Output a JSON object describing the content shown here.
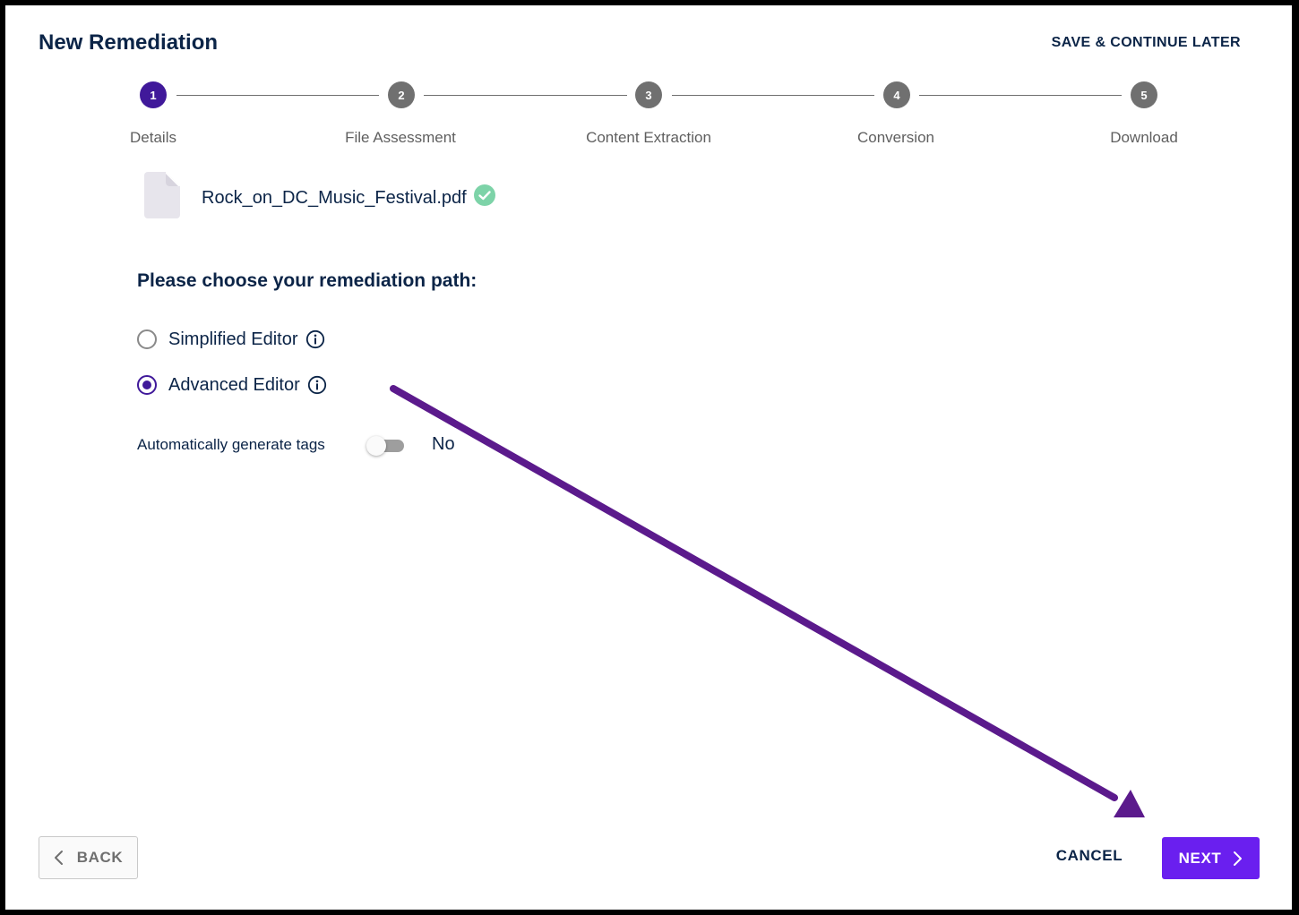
{
  "header": {
    "title": "New Remediation",
    "save_later_label": "SAVE & CONTINUE LATER"
  },
  "stepper": {
    "steps": [
      {
        "number": "1",
        "label": "Details",
        "active": true
      },
      {
        "number": "2",
        "label": "File Assessment",
        "active": false
      },
      {
        "number": "3",
        "label": "Content Extraction",
        "active": false
      },
      {
        "number": "4",
        "label": "Conversion",
        "active": false
      },
      {
        "number": "5",
        "label": "Download",
        "active": false
      }
    ]
  },
  "file": {
    "name": "Rock_on_DC_Music_Festival.pdf",
    "icon": "file-icon",
    "status_icon": "check-circle-icon"
  },
  "remediation": {
    "heading": "Please choose your remediation path:",
    "options": [
      {
        "label": "Simplified Editor",
        "selected": false,
        "info_icon": "info-icon"
      },
      {
        "label": "Advanced Editor",
        "selected": true,
        "info_icon": "info-icon"
      }
    ],
    "auto_tags_label": "Automatically generate tags",
    "auto_tags_value": "No",
    "auto_tags_enabled": false
  },
  "footer": {
    "back_label": "BACK",
    "cancel_label": "CANCEL",
    "next_label": "NEXT"
  },
  "colors": {
    "primary": "#6a1fef",
    "step_active": "#40199a",
    "step_inactive": "#707070",
    "text_dark": "#0b2447",
    "success": "#7dd3a8",
    "annotation": "#5b1a8c"
  }
}
